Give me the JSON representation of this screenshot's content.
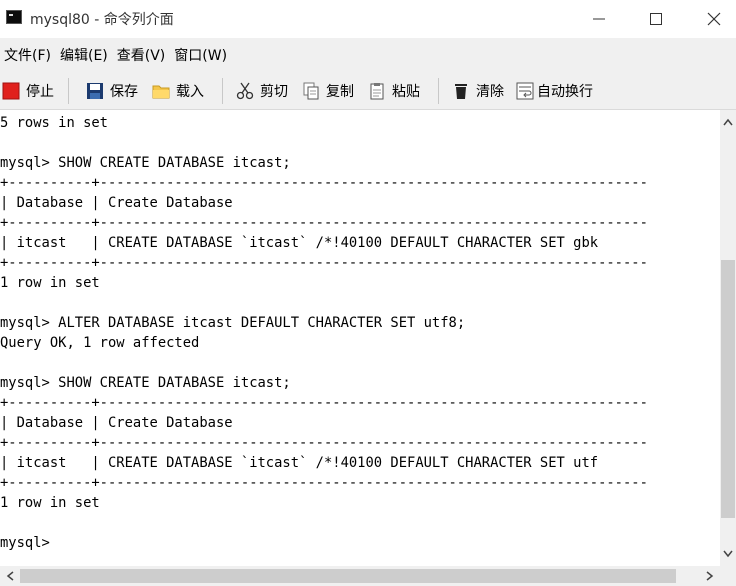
{
  "window": {
    "title": "mysql80 - 命令列介面"
  },
  "menu": [
    "文件(F)",
    "编辑(E)",
    "查看(V)",
    "窗口(W)"
  ],
  "toolbar": {
    "stop": "停止",
    "save": "保存",
    "load": "载入",
    "cut": "剪切",
    "copy": "复制",
    "paste": "粘贴",
    "clear": "清除",
    "wrap": "自动换行"
  },
  "console": {
    "lines": [
      "5 rows in set",
      "",
      "mysql> SHOW CREATE DATABASE itcast;",
      "+----------+------------------------------------------------------------------",
      "| Database | Create Database",
      "+----------+------------------------------------------------------------------",
      "| itcast   | CREATE DATABASE `itcast` /*!40100 DEFAULT CHARACTER SET gbk",
      "+----------+------------------------------------------------------------------",
      "1 row in set",
      "",
      "mysql> ALTER DATABASE itcast DEFAULT CHARACTER SET utf8;",
      "Query OK, 1 row affected",
      "",
      "mysql> SHOW CREATE DATABASE itcast;",
      "+----------+------------------------------------------------------------------",
      "| Database | Create Database",
      "+----------+------------------------------------------------------------------",
      "| itcast   | CREATE DATABASE `itcast` /*!40100 DEFAULT CHARACTER SET utf",
      "+----------+------------------------------------------------------------------",
      "1 row in set",
      "",
      "mysql>"
    ]
  }
}
